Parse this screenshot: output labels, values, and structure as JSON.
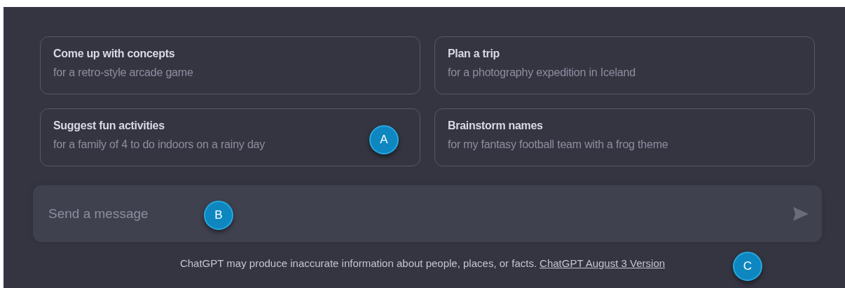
{
  "suggestions": [
    {
      "title": "Come up with concepts",
      "subtitle": "for a retro-style arcade game"
    },
    {
      "title": "Plan a trip",
      "subtitle": "for a photography expedition in Iceland"
    },
    {
      "title": "Suggest fun activities",
      "subtitle": "for a family of 4 to do indoors on a rainy day"
    },
    {
      "title": "Brainstorm names",
      "subtitle": "for my fantasy football team with a frog theme"
    }
  ],
  "composer": {
    "placeholder": "Send a message"
  },
  "footer": {
    "disclaimer": "ChatGPT may produce inaccurate information about people, places, or facts.",
    "link": "ChatGPT August 3 Version"
  },
  "callouts": [
    {
      "label": "A"
    },
    {
      "label": "B"
    },
    {
      "label": "C"
    }
  ]
}
